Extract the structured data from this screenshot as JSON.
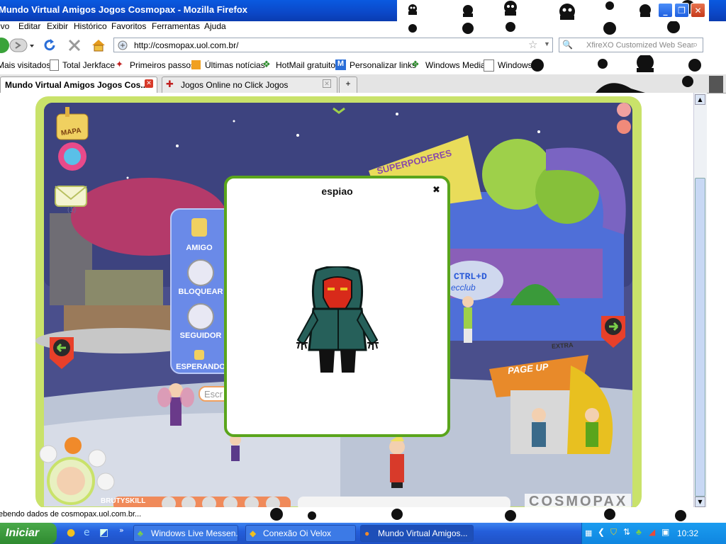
{
  "window": {
    "title": "Mundo Virtual Amigos Jogos Cosmopax - Mozilla Firefox",
    "minimize": "_",
    "restore": "❐",
    "close": "✕"
  },
  "menu": {
    "items": [
      "ivo",
      "Editar",
      "Exibir",
      "Histórico",
      "Favoritos",
      "Ferramentas",
      "Ajuda"
    ]
  },
  "navbar": {
    "url": "http://cosmopax.uol.com.br/",
    "search_placeholder": "XfireXO Customized Web Sear"
  },
  "bookmarks": {
    "items": [
      "Mais visitados",
      "Total Jerkface",
      "Primeiros passos",
      "Últimas notícias",
      "HotMail gratuito",
      "Personalizar links",
      "Windows Media",
      "Windows"
    ]
  },
  "tabs": [
    {
      "label": "Mundo Virtual Amigos Jogos Cos...",
      "active": true
    },
    {
      "label": "Jogos Online no Click Jogos",
      "active": false
    }
  ],
  "game": {
    "map_label": "MAPA",
    "mail_count": "(1)",
    "sidebar": [
      "AMIGO",
      "BLOQUEAR",
      "SEGUIDOR",
      "ESPERANDO"
    ],
    "chat_placeholder": "Escr",
    "player_name": "BRUTYSKILL",
    "logo": "COSMOPAX",
    "signs": {
      "superpoderes": "SUPERPODERES",
      "ctrl": "CTRL+D",
      "club": "ecclub",
      "pageup": "PAGE UP",
      "extra": "EXTRA"
    },
    "popup": {
      "title": "espiao",
      "close": "✖"
    }
  },
  "status": {
    "text": "ebendo dados de cosmopax.uol.com.br..."
  },
  "taskbar": {
    "start": "Iniciar",
    "tasks": [
      "Windows Live Messen...",
      "Conexão Oi Velox",
      "Mundo Virtual Amigos..."
    ],
    "clock": "10:32"
  }
}
